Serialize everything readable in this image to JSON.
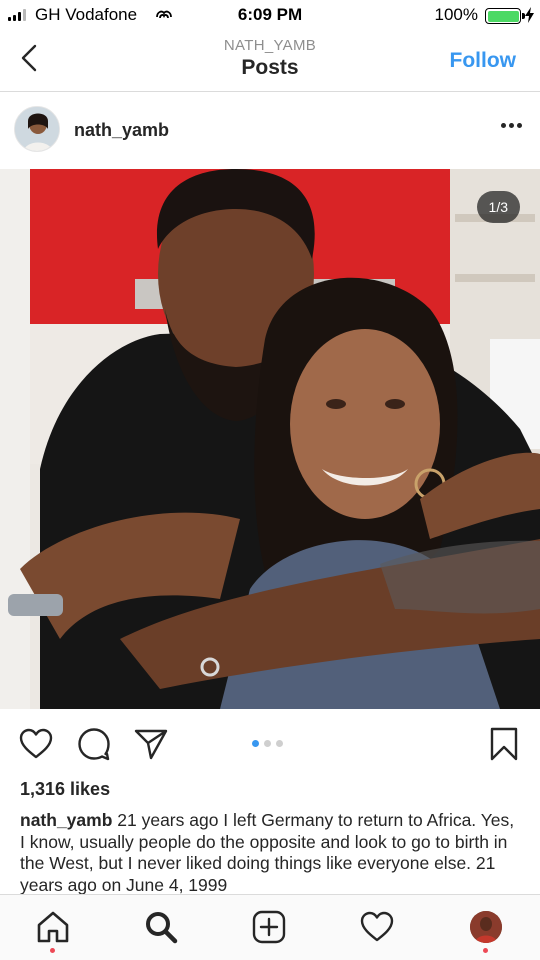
{
  "status_bar": {
    "carrier": "GH Vodafone",
    "time": "6:09 PM",
    "battery_percent": "100%",
    "battery_level": 1.0,
    "signal_bars": 3
  },
  "header": {
    "subtitle": "NATH_YAMB",
    "title": "Posts",
    "follow_label": "Follow"
  },
  "post": {
    "username": "nath_yamb",
    "image_counter": "1/3",
    "carousel": {
      "count": 3,
      "active": 1
    },
    "likes": "1,316 likes",
    "caption_user": "nath_yamb",
    "caption_text": " 21 years ago I left Germany to return to Africa. Yes, I know, usually people do the opposite and look to go to birth in the West, but I never liked doing things like everyone else. 21 years ago on June 4, 1999"
  },
  "icons": {
    "back": "chevron-left-icon",
    "more": "more-options-icon",
    "like": "heart-icon",
    "comment": "comment-icon",
    "share": "send-icon",
    "save": "bookmark-icon",
    "home": "home-icon",
    "search": "search-icon",
    "new_post": "add-post-icon",
    "activity": "heart-icon",
    "profile": "profile-avatar"
  },
  "colors": {
    "accent": "#3897f0",
    "text": "#262626",
    "muted": "#8e8e8e",
    "notification": "#ed4956",
    "battery": "#4cd964"
  }
}
